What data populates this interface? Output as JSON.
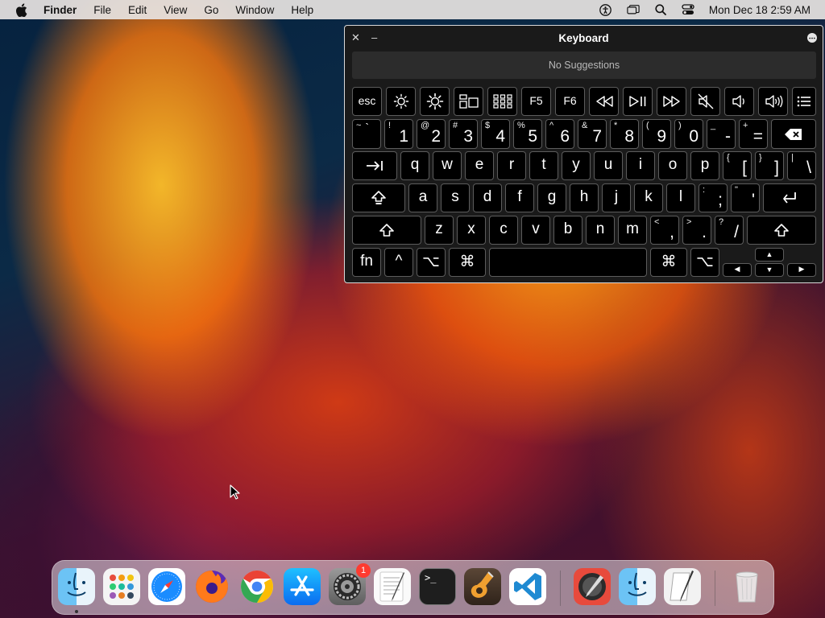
{
  "menubar": {
    "app_name": "Finder",
    "menus": [
      "File",
      "Edit",
      "View",
      "Go",
      "Window",
      "Help"
    ],
    "status_icons": [
      "accessibility-icon",
      "screen-mirroring-icon",
      "spotlight-search-icon",
      "control-center-icon"
    ],
    "clock": "Mon Dec 18  2:59 AM"
  },
  "keyboard_viewer": {
    "title": "Keyboard",
    "close_symbol": "✕",
    "minimize_symbol": "–",
    "suggestions": "No Suggestions",
    "function_row": {
      "esc": "esc",
      "brightness_down_icon": "brightness-down-icon",
      "brightness_up_icon": "brightness-up-icon",
      "mission_control_icon": "mission-control-icon",
      "launchpad_icon": "launchpad-icon",
      "f5": "F5",
      "f6": "F6",
      "rewind_icon": "rewind-icon",
      "play_pause_icon": "play-pause-icon",
      "fast_forward_icon": "fast-forward-icon",
      "mute_icon": "mute-icon",
      "volume_down_icon": "volume-down-icon",
      "volume_up_icon": "volume-up-icon",
      "list_icon": "list-icon"
    },
    "number_row": [
      {
        "shift": "~",
        "main": "`"
      },
      {
        "shift": "!",
        "main": "1"
      },
      {
        "shift": "@",
        "main": "2"
      },
      {
        "shift": "#",
        "main": "3"
      },
      {
        "shift": "$",
        "main": "4"
      },
      {
        "shift": "%",
        "main": "5"
      },
      {
        "shift": "^",
        "main": "6"
      },
      {
        "shift": "&",
        "main": "7"
      },
      {
        "shift": "*",
        "main": "8"
      },
      {
        "shift": "(",
        "main": "9"
      },
      {
        "shift": ")",
        "main": "0"
      },
      {
        "shift": "_",
        "main": "-"
      },
      {
        "shift": "+",
        "main": "="
      }
    ],
    "top_row": [
      "q",
      "w",
      "e",
      "r",
      "t",
      "y",
      "u",
      "i",
      "o",
      "p"
    ],
    "top_row_brackets": [
      {
        "shift": "{",
        "main": "["
      },
      {
        "shift": "}",
        "main": "]"
      },
      {
        "shift": "|",
        "main": "\\"
      }
    ],
    "home_row": [
      "a",
      "s",
      "d",
      "f",
      "g",
      "h",
      "j",
      "k",
      "l"
    ],
    "home_row_punct": [
      {
        "shift": ":",
        "main": ";"
      },
      {
        "shift": "\"",
        "main": "'"
      }
    ],
    "bottom_row": [
      "z",
      "x",
      "c",
      "v",
      "b",
      "n",
      "m"
    ],
    "bottom_row_punct": [
      {
        "shift": "<",
        "main": ","
      },
      {
        "shift": ">",
        "main": "."
      },
      {
        "shift": "?",
        "main": "/"
      }
    ],
    "modifiers": {
      "fn": "fn",
      "control": "^",
      "option": "⌥",
      "command": "⌘"
    },
    "arrows": {
      "up": "▲",
      "left": "◀",
      "down": "▼",
      "right": "▶"
    }
  },
  "dock": {
    "apps": [
      {
        "name": "Finder",
        "icon": "finder-icon",
        "running": true
      },
      {
        "name": "Launchpad",
        "icon": "launchpad-icon"
      },
      {
        "name": "Safari",
        "icon": "safari-icon"
      },
      {
        "name": "Firefox",
        "icon": "firefox-icon"
      },
      {
        "name": "Google Chrome",
        "icon": "chrome-icon"
      },
      {
        "name": "App Store",
        "icon": "app-store-icon"
      },
      {
        "name": "System Settings",
        "icon": "system-settings-icon",
        "badge": "1"
      },
      {
        "name": "TextEdit",
        "icon": "textedit-icon"
      },
      {
        "name": "Terminal",
        "icon": "terminal-icon"
      },
      {
        "name": "GarageBand",
        "icon": "garageband-icon"
      },
      {
        "name": "Visual Studio Code",
        "icon": "vscode-icon"
      },
      {
        "name": "Digital Color Meter",
        "icon": "color-meter-icon"
      },
      {
        "name": "Finder",
        "icon": "finder-icon-2"
      },
      {
        "name": "Script Editor",
        "icon": "script-editor-icon"
      },
      {
        "name": "Trash",
        "icon": "trash-icon"
      }
    ],
    "terminal_prompt": ">_"
  },
  "colors": {
    "accent": "#007aff",
    "badge": "#ff3b30",
    "keyboard_bg": "#1a1a1a",
    "key_bg": "#000000"
  }
}
